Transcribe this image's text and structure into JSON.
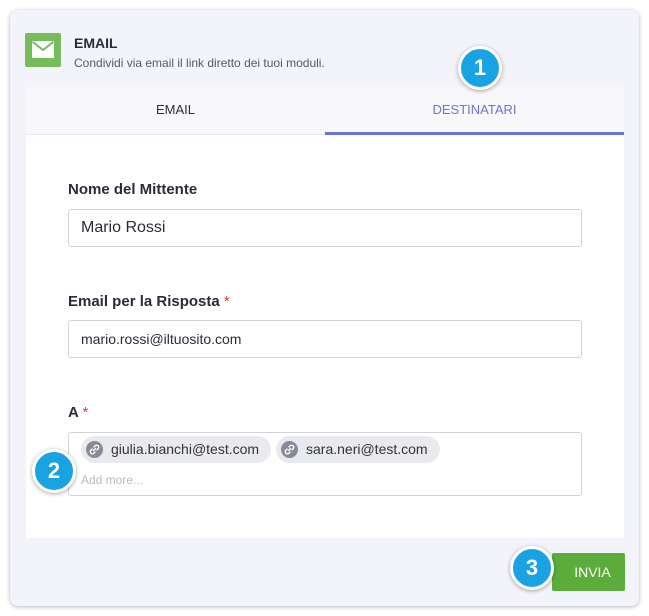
{
  "header": {
    "icon": "envelope-icon",
    "title": "EMAIL",
    "subtitle": "Condividi via email il link diretto dei tuoi moduli."
  },
  "tabs": [
    {
      "label": "EMAIL",
      "active": false
    },
    {
      "label": "DESTINATARI",
      "active": true
    }
  ],
  "form": {
    "sender_label": "Nome del Mittente",
    "sender_value": "Mario Rossi",
    "reply_label": "Email per la Risposta",
    "reply_value": "mario.rossi@iltuosito.com",
    "required_mark": "*",
    "to_label": "A",
    "recipients": [
      {
        "email": "giulia.bianchi@test.com",
        "icon": "link-icon"
      },
      {
        "email": "sara.neri@test.com",
        "icon": "link-icon"
      }
    ],
    "add_more_placeholder": "Add more..."
  },
  "actions": {
    "send_label": "INVIA"
  },
  "steps": [
    "1",
    "2",
    "3"
  ],
  "colors": {
    "accent": "#6b74d6",
    "send_button": "#5cac3b",
    "header_icon": "#78bb5a",
    "step_badge": "#1aa3e3",
    "required": "#e03a3a"
  }
}
